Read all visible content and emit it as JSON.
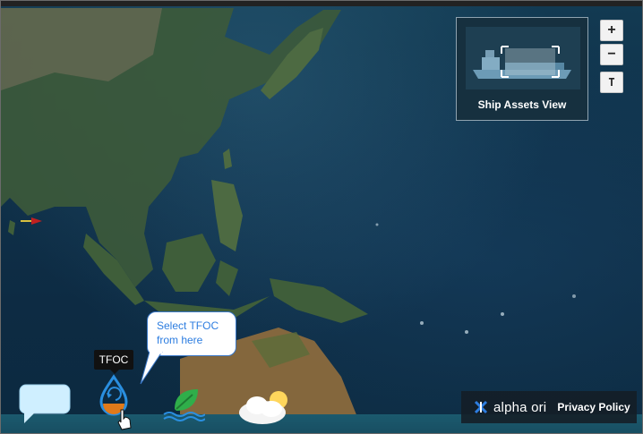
{
  "ship_assets": {
    "label": "Ship Assets View",
    "icon": "ship-icon"
  },
  "map_controls": {
    "zoom_in": "+",
    "zoom_out": "−",
    "toggle": "T"
  },
  "tooltip": {
    "tfoc": "TFOC"
  },
  "callout": {
    "text": "Select TFOC from here"
  },
  "bottom_icons": [
    {
      "name": "chat-icon"
    },
    {
      "name": "tfoc-icon"
    },
    {
      "name": "leaf-water-icon"
    },
    {
      "name": "weather-icon"
    }
  ],
  "brand": {
    "logo": "alpha ori",
    "privacy": "Privacy Policy"
  },
  "colors": {
    "accent": "#2d7de0",
    "bottom_bar": "#1b5a6e",
    "callout_border": "#3a78c8"
  }
}
